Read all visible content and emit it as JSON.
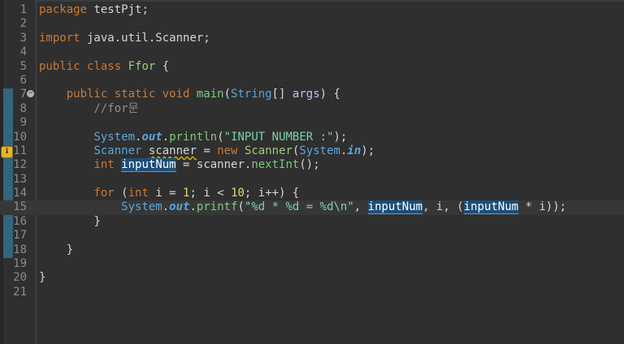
{
  "editor": {
    "colors": {
      "background": "#2f2f2f",
      "keyword": "#cc7832",
      "string": "#79d4a8",
      "highlight": "#1c4e78",
      "gutter_fold": "#2c5f78"
    },
    "markers": {
      "fold_toggle_icon": "circle-minus-icon",
      "fold_glyph": "−",
      "warning_icon": "lightbulb-warning-icon",
      "warning_glyph": "ℹ"
    },
    "lines": [
      {
        "n": "1",
        "package_kw": "package",
        "text": " testPjt;"
      },
      {
        "n": "2"
      },
      {
        "n": "3",
        "import_kw": "import",
        "text": " java.util.Scanner;"
      },
      {
        "n": "4"
      },
      {
        "n": "5",
        "public_kw": "public",
        "class_kw": "class",
        "class_name": "Ffor",
        "brace": "{"
      },
      {
        "n": "6"
      },
      {
        "n": "7",
        "mods": "public static void",
        "method": "main",
        "paren_open": "(",
        "type": "String",
        "brackets": "[]",
        "param": "args",
        "rest": ") {"
      },
      {
        "n": "8",
        "comment": "//for문"
      },
      {
        "n": "9"
      },
      {
        "n": "10",
        "sys": "System",
        "dot": ".",
        "out": "out",
        "dot2": ".",
        "method": "println",
        "paren_open": "(",
        "str": "\"INPUT NUMBER :\"",
        "rest": ");"
      },
      {
        "n": "11",
        "type": "Scanner",
        "var": "scanner",
        "eq": " = ",
        "new_kw": "new",
        "ctor": "Scanner",
        "paren_open": "(",
        "sys": "System",
        "dot": ".",
        "in": "in",
        "rest": ");"
      },
      {
        "n": "12",
        "int_kw": "int",
        "var": "inputNum",
        "eq": " = scanner.",
        "method": "nextInt",
        "rest": "();"
      },
      {
        "n": "13"
      },
      {
        "n": "14",
        "for_kw": "for",
        "p1": " (",
        "int_kw": "int",
        "p2": " i = ",
        "n1": "1",
        "p3": "; i < ",
        "n2": "10",
        "p4": "; i++) {"
      },
      {
        "n": "15",
        "sys": "System",
        "dot": ".",
        "out": "out",
        "dot2": ".",
        "method": "printf",
        "paren_open": "(",
        "str": "\"%d * %d = %d\\n\"",
        "comma1": ", ",
        "var1": "inputNum",
        "mid": ", i, (",
        "var2": "inputNum",
        "tail": " * i));"
      },
      {
        "n": "16",
        "text": "}"
      },
      {
        "n": "17"
      },
      {
        "n": "18",
        "text": "}"
      },
      {
        "n": "19"
      },
      {
        "n": "20",
        "text": "}"
      },
      {
        "n": "21"
      }
    ]
  }
}
